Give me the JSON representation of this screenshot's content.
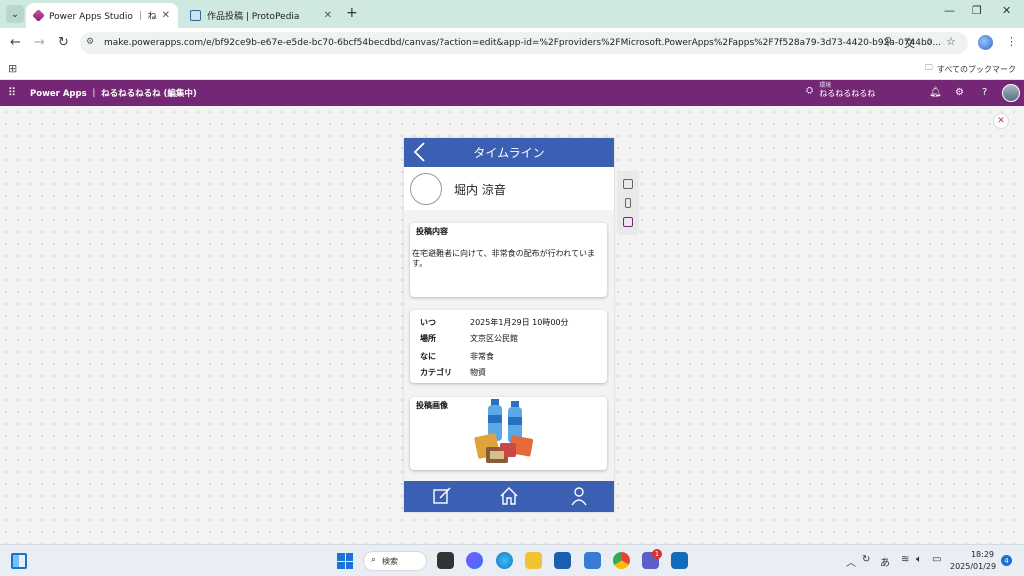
{
  "browser": {
    "tabs": [
      {
        "label": "Power Apps Studio ｜ ねるねるね",
        "active": true
      },
      {
        "label": "作品投稿 | ProtoPedia",
        "active": false
      }
    ],
    "url": "make.powerapps.com/e/bf92ce9b-e67e-e5de-bc70-6bcf54becdbd/canvas/?action=edit&app-id=%2Fproviders%2FMicrosoft.PowerApps%2Fapps%2F7f528a79-3d73-4420-b92a-0744b0...",
    "bookmarks_all": "すべてのブックマーク"
  },
  "powerapps": {
    "title": "Power Apps ｜ ねるねるねるね (編集中)",
    "env_label": "環境",
    "env_name": "ねるねるねるね",
    "brand_color": "#742774"
  },
  "app": {
    "header_title": "タイムライン",
    "user_name": "堀内 涼音",
    "post_card": {
      "title": "投稿内容",
      "body": "在宅避難者に向けて、非常食の配布が行われています。"
    },
    "info_card": {
      "rows": [
        {
          "label": "いつ",
          "value": "2025年1月29日 10時00分"
        },
        {
          "label": "場所",
          "value": "文京区公民館"
        },
        {
          "label": "なに",
          "value": "非常食"
        },
        {
          "label": "カテゴリ",
          "value": "物資"
        }
      ]
    },
    "image_card": {
      "title": "投稿画像"
    },
    "accent_color": "#3a5fb3"
  },
  "taskbar": {
    "search_label": "検索",
    "teams_badge": "1",
    "ime": "あ",
    "time": "18:29",
    "date": "2025/01/29",
    "notifications": "4"
  }
}
